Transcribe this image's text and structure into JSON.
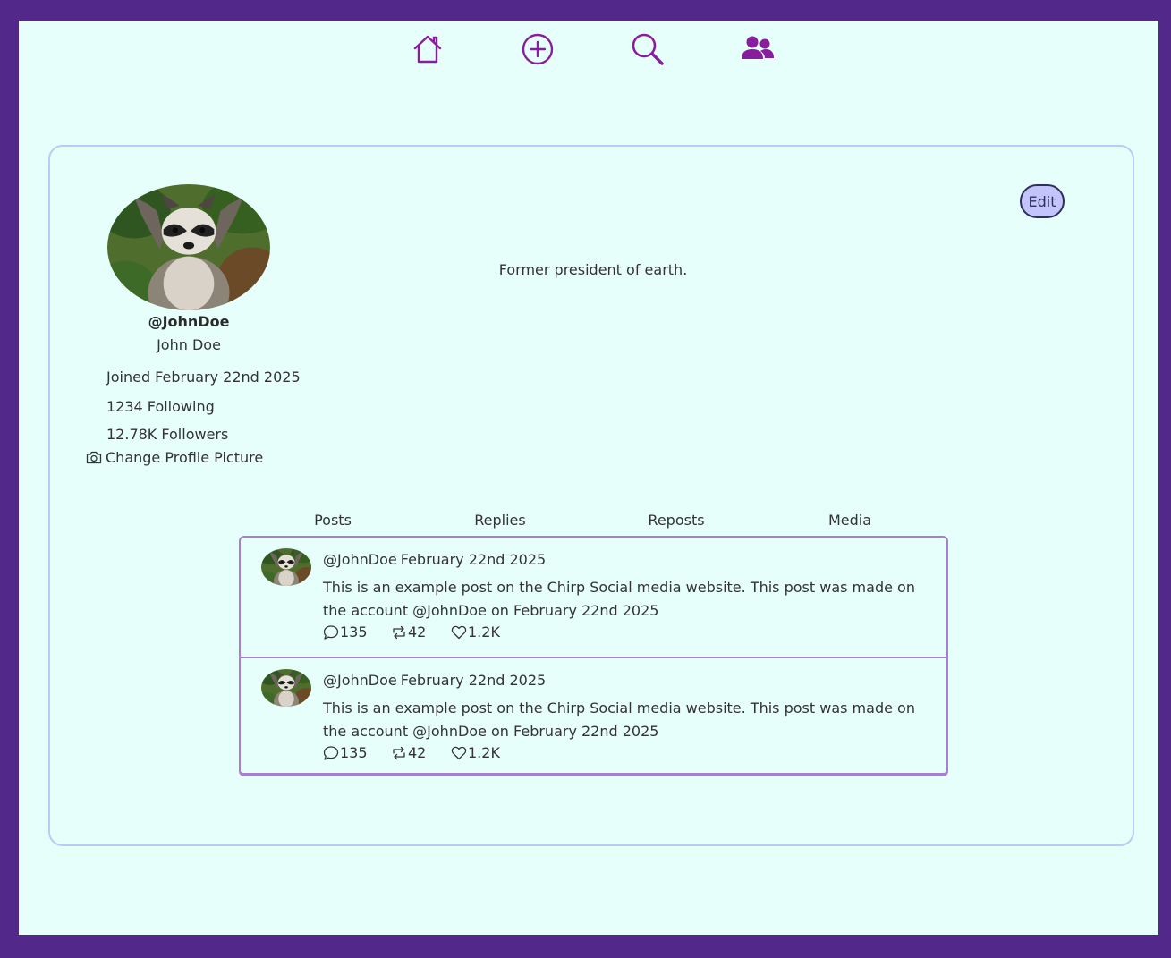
{
  "nav": {
    "items": [
      {
        "icon": "home-icon"
      },
      {
        "icon": "plus-circle-icon"
      },
      {
        "icon": "search-icon"
      },
      {
        "icon": "users-icon"
      }
    ],
    "accent": "#8a1d9e"
  },
  "profile": {
    "handle": "@JohnDoe",
    "name": "John Doe",
    "joined": "Joined February 22nd 2025",
    "following": "1234 Following",
    "followers": "12.78K Followers",
    "change_picture": "Change Profile Picture",
    "bio": "Former president of earth.",
    "edit_label": "Edit"
  },
  "tabs": [
    {
      "label": "Posts"
    },
    {
      "label": "Replies"
    },
    {
      "label": "Reposts"
    },
    {
      "label": "Media"
    }
  ],
  "posts": [
    {
      "handle": "@JohnDoe",
      "date": "February 22nd 2025",
      "text": "This is an example post on the Chirp Social media website. This post was made on the account @JohnDoe on February 22nd 2025",
      "replies": "135",
      "reposts": "42",
      "likes": "1.2K"
    },
    {
      "handle": "@JohnDoe",
      "date": "February 22nd 2025",
      "text": "This is an example post on the Chirp Social media website. This post was made on the account @JohnDoe on February 22nd 2025",
      "replies": "135",
      "reposts": "42",
      "likes": "1.2K"
    }
  ],
  "colors": {
    "page_border": "#52288a",
    "background": "#e7fffb",
    "card_border": "#b9ccf3",
    "feed_border": "#a67fcf",
    "edit_fill": "#c3c4fb"
  }
}
